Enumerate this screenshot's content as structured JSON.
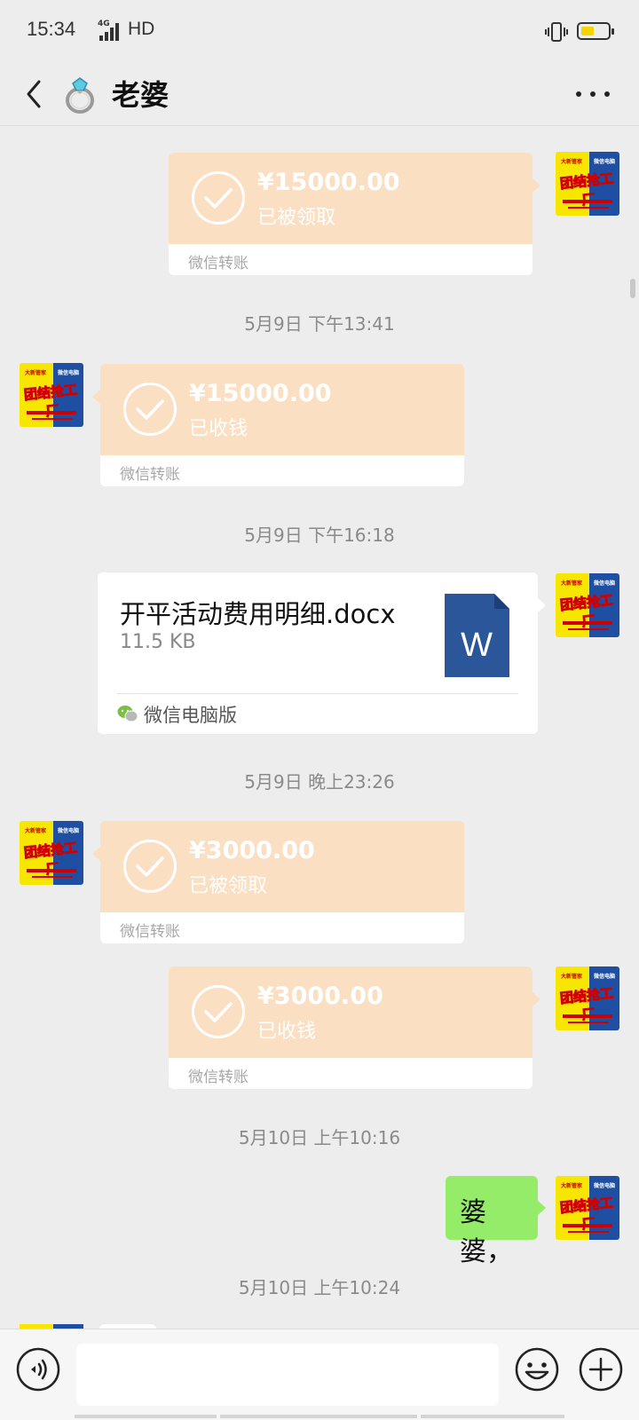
{
  "status_bar": {
    "time": "15:34",
    "network": "4G",
    "hd": "HD",
    "battery_level": 0.45
  },
  "header": {
    "contact_name": "老婆",
    "back_icon": "chevron-left-icon",
    "contact_icon": "ring-icon",
    "more_icon": "more-dots-icon"
  },
  "avatar": {
    "top_left": "大新管家",
    "top_right": "微信电脑",
    "main": "团结抢工厂"
  },
  "messages": [
    {
      "type": "transfer",
      "side": "right",
      "amount": "¥15000.00",
      "status": "已被领取",
      "source": "微信转账"
    },
    {
      "type": "timestamp",
      "text": "5月9日 下午13:41"
    },
    {
      "type": "transfer",
      "side": "left",
      "amount": "¥15000.00",
      "status": "已收钱",
      "source": "微信转账"
    },
    {
      "type": "timestamp",
      "text": "5月9日 下午16:18"
    },
    {
      "type": "file",
      "side": "right",
      "file_name": "开平活动费用明细.docx",
      "file_size": "11.5 KB",
      "file_icon_letter": "W",
      "source": "微信电脑版"
    },
    {
      "type": "timestamp",
      "text": "5月9日 晚上23:26"
    },
    {
      "type": "transfer",
      "side": "left",
      "amount": "¥3000.00",
      "status": "已被领取",
      "source": "微信转账"
    },
    {
      "type": "transfer",
      "side": "right",
      "amount": "¥3000.00",
      "status": "已收钱",
      "source": "微信转账"
    },
    {
      "type": "timestamp",
      "text": "5月10日 上午10:16"
    },
    {
      "type": "text",
      "side": "right",
      "text": "婆婆，"
    },
    {
      "type": "timestamp",
      "text": "5月10日 上午10:24"
    }
  ],
  "input_bar": {
    "voice_icon": "voice-icon",
    "input_value": "",
    "emoji_icon": "emoji-icon",
    "plus_icon": "plus-icon"
  },
  "colors": {
    "background": "#ededed",
    "transfer_card": "#fbdfc2",
    "text_bubble": "#95ec69",
    "word_blue": "#2b579a"
  }
}
